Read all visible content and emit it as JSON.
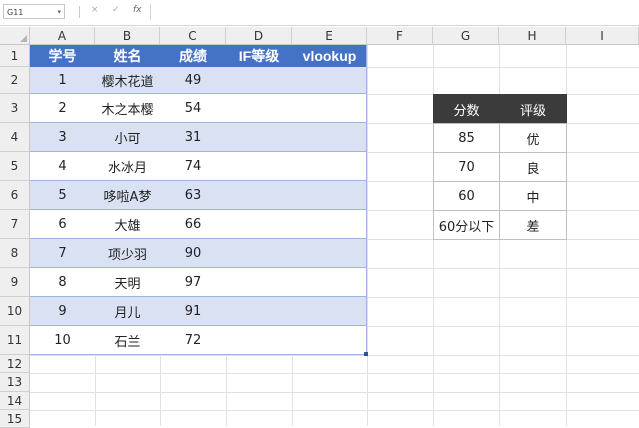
{
  "formula_bar": {
    "name_box": "G11",
    "cancel_icon": "×",
    "enter_icon": "✓",
    "fx_icon": "fx",
    "formula": ""
  },
  "columns": [
    "A",
    "B",
    "C",
    "D",
    "E",
    "F",
    "G",
    "H",
    "I"
  ],
  "rows": [
    "1",
    "2",
    "3",
    "4",
    "5",
    "6",
    "7",
    "8",
    "9",
    "10",
    "11",
    "12",
    "13",
    "14",
    "15"
  ],
  "main_table": {
    "headers": [
      "学号",
      "姓名",
      "成绩",
      "IF等级",
      "vlookup"
    ],
    "rows": [
      [
        "1",
        "樱木花道",
        "49",
        "",
        ""
      ],
      [
        "2",
        "木之本樱",
        "54",
        "",
        ""
      ],
      [
        "3",
        "小可",
        "31",
        "",
        ""
      ],
      [
        "4",
        "水冰月",
        "74",
        "",
        ""
      ],
      [
        "5",
        "哆啦A梦",
        "63",
        "",
        ""
      ],
      [
        "6",
        "大雄",
        "66",
        "",
        ""
      ],
      [
        "7",
        "项少羽",
        "90",
        "",
        ""
      ],
      [
        "8",
        "天明",
        "97",
        "",
        ""
      ],
      [
        "9",
        "月儿",
        "91",
        "",
        ""
      ],
      [
        "10",
        "石兰",
        "72",
        "",
        ""
      ]
    ]
  },
  "grade_table": {
    "headers": [
      "分数",
      "评级"
    ],
    "rows": [
      [
        "85",
        "优"
      ],
      [
        "70",
        "良"
      ],
      [
        "60",
        "中"
      ],
      [
        "60分以下",
        "差"
      ]
    ]
  },
  "colors": {
    "header_blue": "#4472c4",
    "band_blue": "#d9e1f2",
    "grade_header": "#3b3b3b"
  }
}
